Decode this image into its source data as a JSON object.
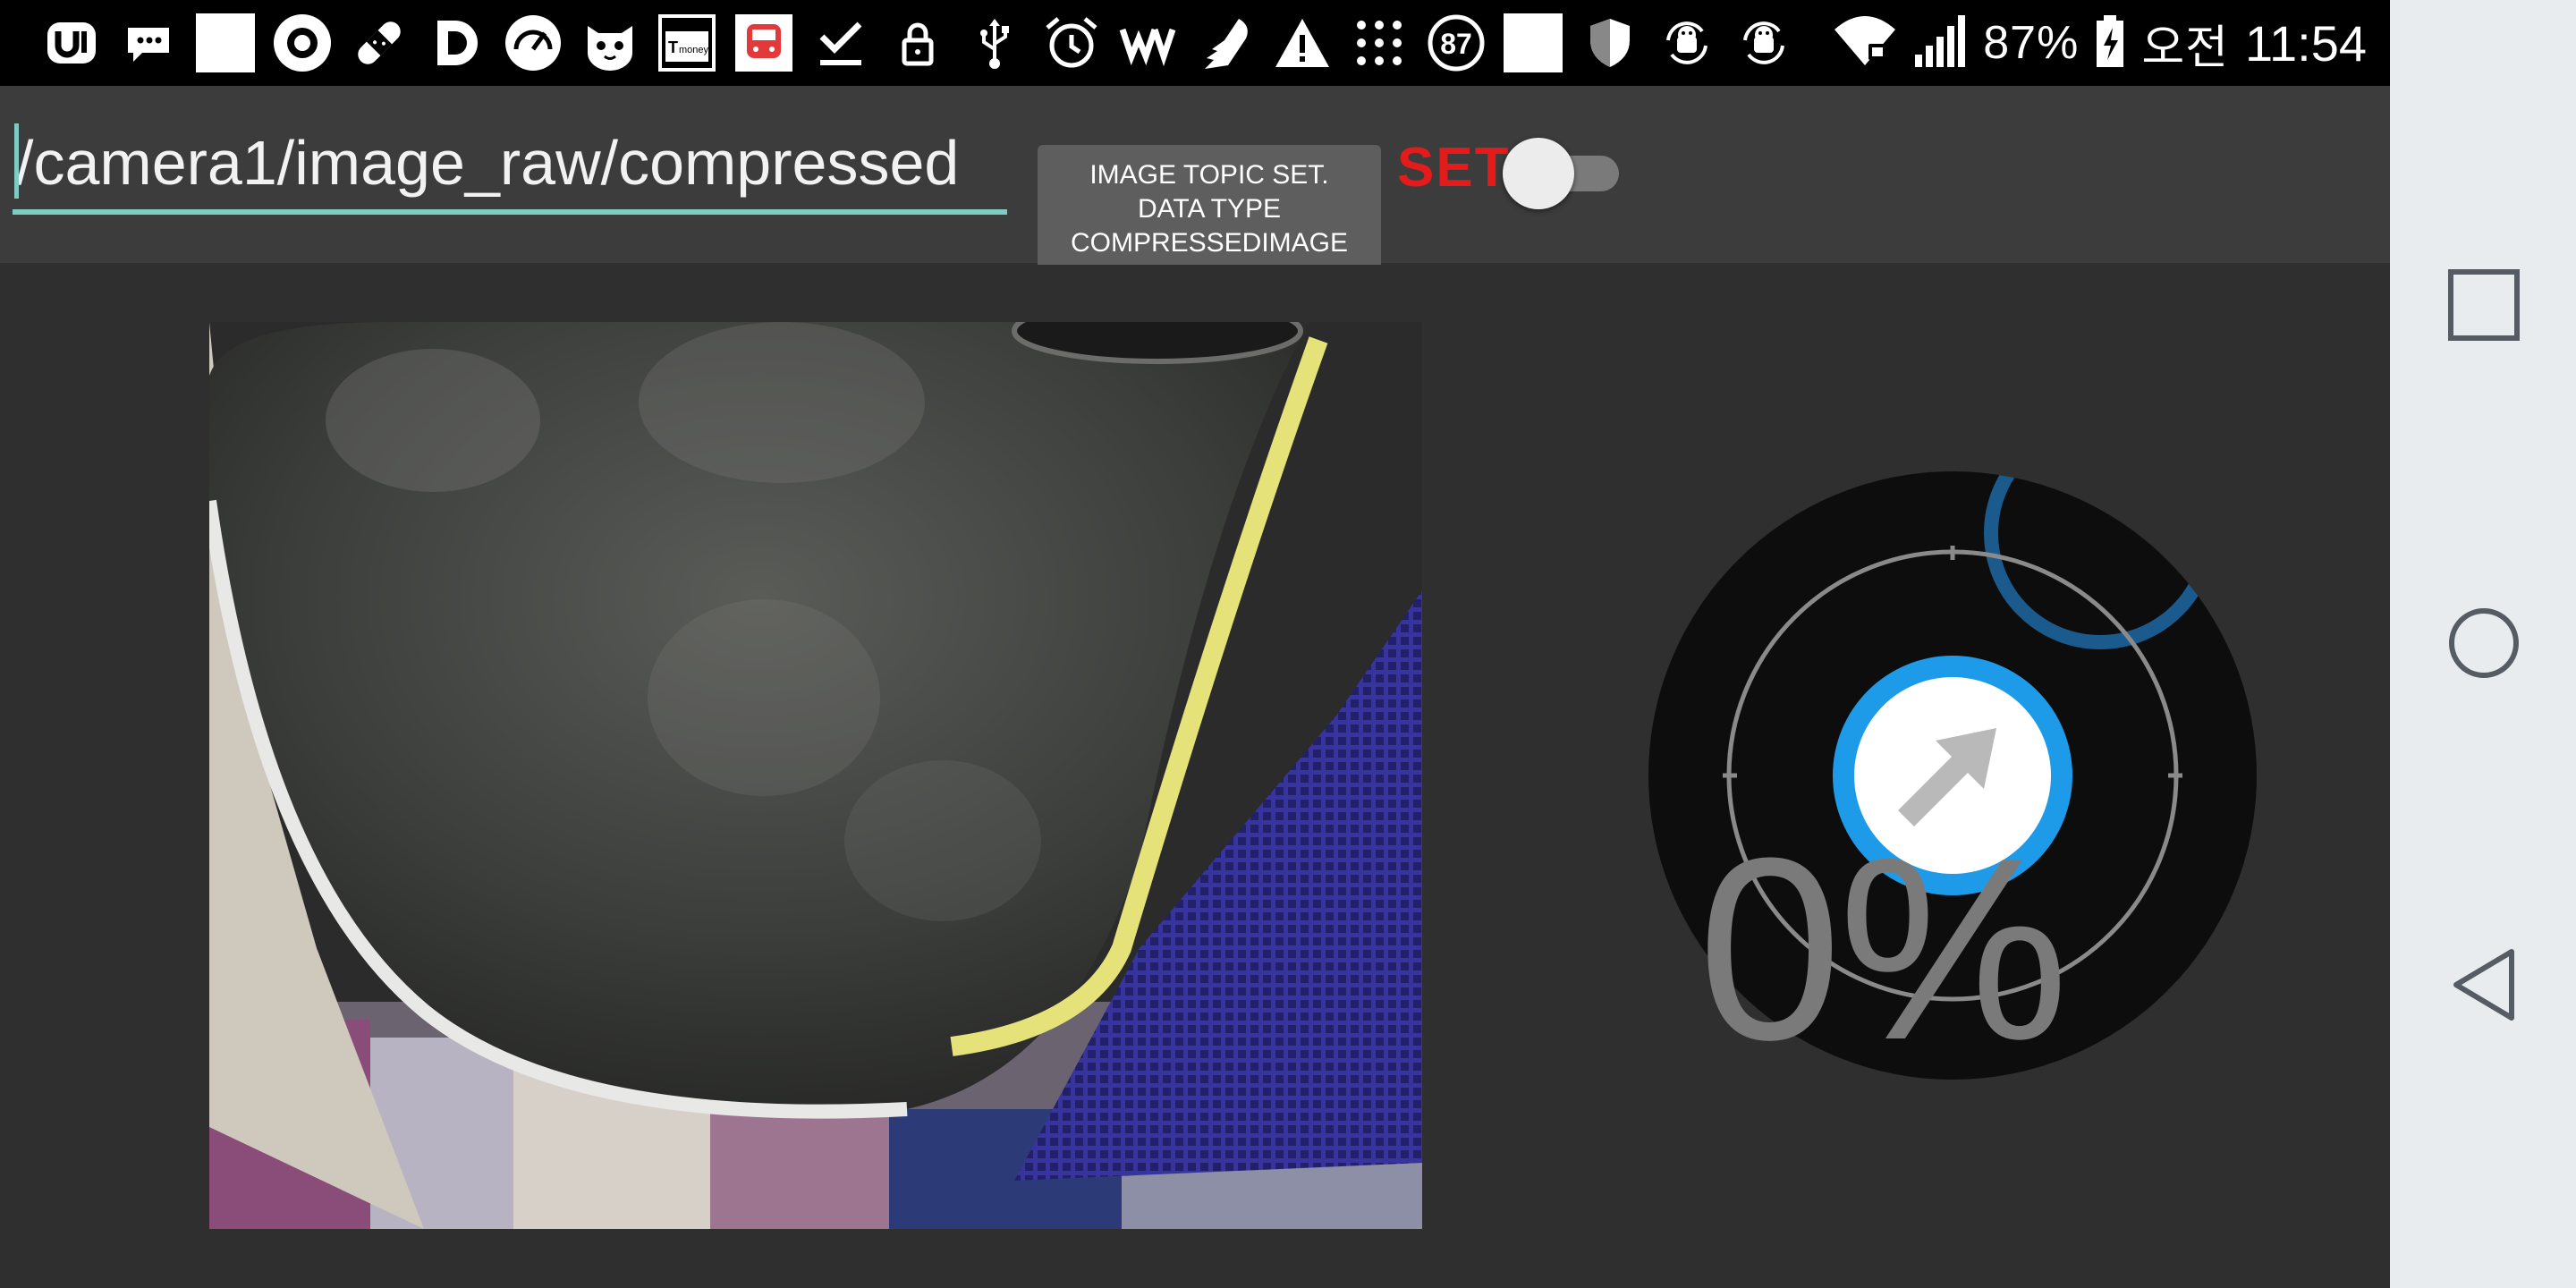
{
  "status_bar": {
    "left_icons": [
      "u-app-icon",
      "chat-icon",
      "blank-square-icon",
      "target-icon",
      "bandage-icon",
      "d-app-icon",
      "gauge-icon",
      "cat-face-icon",
      "tmoney-icon",
      "bus-icon",
      "download-done-icon",
      "lock-icon",
      "usb-icon",
      "alarm-icon",
      "w-app-icon",
      "wing-icon",
      "warning-icon",
      "grid-icon",
      "badge-87-icon",
      "blank-square-icon",
      "shield-icon",
      "android-sync-icon",
      "android-sync-icon"
    ],
    "badge_number": "87",
    "tmoney_label": "money",
    "tmoney_t": "T",
    "battery": "87%",
    "period": "오전",
    "time": "11:54"
  },
  "toolbar": {
    "topic_value": "/camera1/image_raw/compressed",
    "set_topic_button_lines": [
      "IMAGE TOPIC SET.",
      "DATA TYPE",
      "COMPRESSEDIMAGE"
    ],
    "set_label": "SET",
    "toggle_on": false
  },
  "joystick": {
    "percent": "0%",
    "accent_color": "#1e9be8"
  },
  "navbar": {
    "buttons": [
      "recents-icon",
      "home-icon",
      "back-icon"
    ]
  },
  "colors": {
    "toolbar_bg": "#3c3c3c",
    "content_bg": "#2f2f2f",
    "set_red": "#e31b1b",
    "underline_teal": "#80cbc4"
  }
}
